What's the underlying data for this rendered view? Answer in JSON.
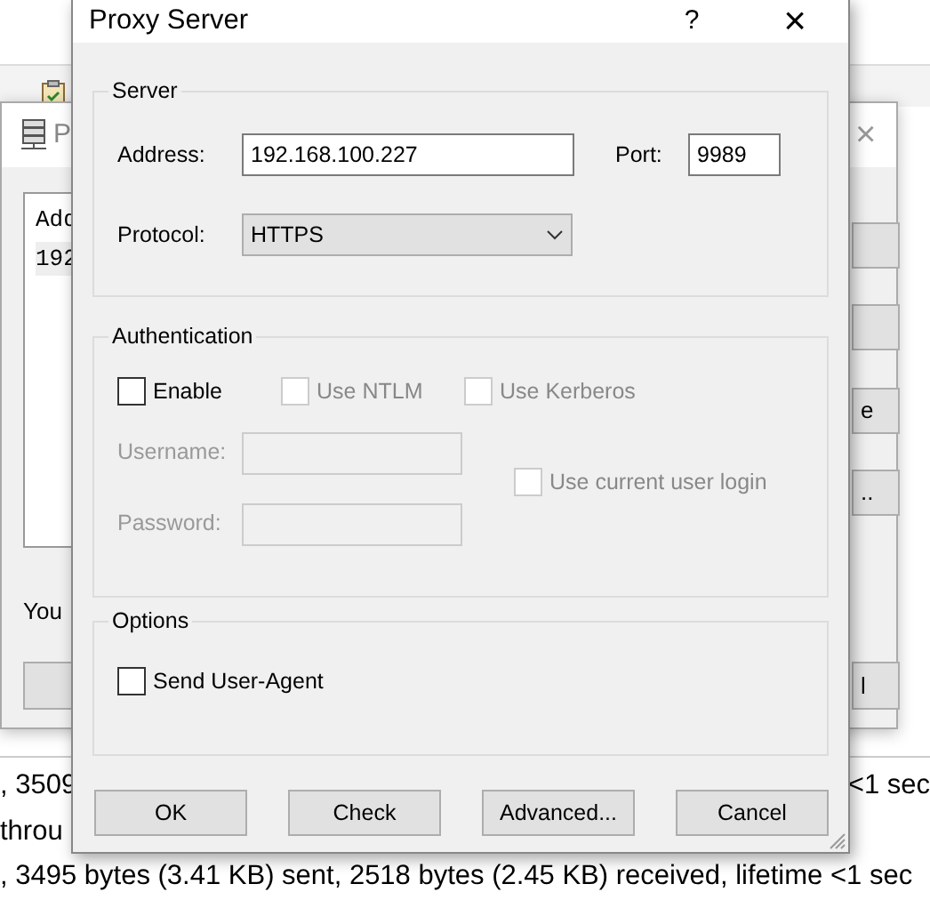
{
  "background_app": {
    "log_lines": [
      {
        "left": ", 3509",
        "right": "<1 sec"
      },
      {
        "left": " throu"
      },
      {
        "left": ", 3495 bytes (3.41 KB) sent, 2518 bytes (2.45 KB) received, lifetime <1 sec"
      }
    ]
  },
  "middle_window": {
    "title": "P",
    "close": "×",
    "list_header": "Add",
    "list_row": "192",
    "hint": "You",
    "side_buttons": [
      {
        "kind": "blank"
      },
      {
        "kind": "blank"
      },
      {
        "kind": "text",
        "label": "e"
      },
      {
        "kind": "text",
        "label": ".."
      }
    ],
    "bottom_right_button": "l"
  },
  "dialog": {
    "title": "Proxy Server",
    "help": "?",
    "close": "×",
    "server": {
      "title": "Server",
      "address_label": "Address:",
      "address": "192.168.100.227",
      "port_label": "Port:",
      "port": "9989",
      "protocol_label": "Protocol:",
      "protocol": "HTTPS"
    },
    "authentication": {
      "title": "Authentication",
      "checkboxes": [
        {
          "label": "Enable",
          "checked": false,
          "disabled": false
        },
        {
          "label": "Use NTLM",
          "checked": false,
          "disabled": true
        },
        {
          "label": "Use Kerberos",
          "checked": false,
          "disabled": true
        }
      ],
      "username_label": "Username:",
      "password_label": "Password:",
      "fields_disabled": true,
      "current_user": {
        "label": "Use current user login",
        "checked": false,
        "disabled": true
      }
    },
    "options": {
      "title": "Options",
      "checkboxes": [
        {
          "label": "Send User-Agent",
          "checked": false,
          "disabled": false
        }
      ]
    },
    "buttons": [
      "OK",
      "Check",
      "Advanced...",
      "Cancel"
    ]
  }
}
